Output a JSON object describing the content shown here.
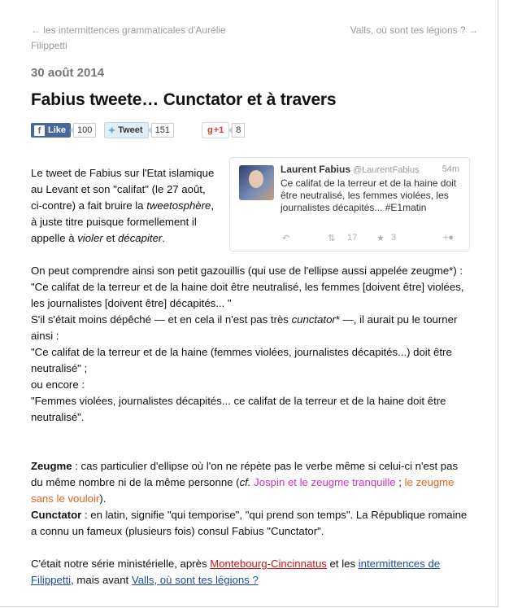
{
  "nav": {
    "prev_arrow": "←",
    "prev": "les intermittences grammaticales d'Aurélie Filippetti",
    "next": "Valls, où sont tes légions ?",
    "next_arrow": "→"
  },
  "post": {
    "date": "30 août 2014",
    "title": "Fabius tweete… Cunctator et à travers"
  },
  "share": {
    "fb_label": "Like",
    "fb_count": "100",
    "tw_label": "Tweet",
    "tw_count": "151",
    "gp_label": "+1",
    "gp_count": "8"
  },
  "tweet": {
    "name": "Laurent Fabius",
    "handle": "@LaurentFabius",
    "time": "54m",
    "text": "Ce califat de la terreur et de la haine doit être neutralisé, les femmes violées, les journalistes décapités... #E1matin",
    "retweets": "17",
    "favorites": "3"
  },
  "content": {
    "p1_a": "Le tweet de Fabius sur l'Etat islamique au Levant et son \"califat\" (le 27 août, ci-contre) a fait bruire la ",
    "p1_b": "tweetosphère",
    "p1_c": ", à juste titre puisque formellement il appelle à ",
    "p1_d": "violer",
    "p1_e": " et ",
    "p1_f": "décapiter",
    "p1_g": ".",
    "p2_a": "On peut comprendre ainsi son petit gazouillis (qui use de l'ellipse aussi appelée zeugme*) :",
    "p2_b": "\"Ce califat de la terreur et de la haine doit être neutralisé, les femmes [doivent être] violées, les journalistes [doivent être] décapités... \"",
    "p2_c": "S'il s'était moins dépêché — et en cela il n'est pas très ",
    "p2_d": "cunctator",
    "p2_e": "* —, il aurait pu le tourner ainsi :",
    "p2_f": "\"Ce califat de la terreur et de la haine (femmes violées, journalistes décapités...) doit être neutralisé\" ;",
    "p2_g": "ou encore :",
    "p2_h": "\"Femmes violées, journalistes décapités... ce califat de la terreur et de la haine doit être neutralisé\".",
    "p3_term1": "Zeugme",
    "p3_a": " : cas particulier d'ellipse où l'on ne répète pas le verbe même si celui-ci n'est pas du même nombre ni de la même personne (",
    "p3_cf": "cf.",
    "p3_link1": "Jospin et le zeugme tranquille",
    "p3_sep": " ; ",
    "p3_link2": "le zeugme sans le vouloir",
    "p3_b": ").",
    "p3_term2": "Cunctator",
    "p3_c": " : en latin, signifie \"qui temporise\", \"qui prend son temps\". La République romaine a connu un fameux (plusieurs fois) consul Fabius \"Cunctator\".",
    "p4_a": "C'était notre série ministérielle, après ",
    "p4_link1": "Montebourg-Cincinnatus",
    "p4_b": " et les ",
    "p4_link2": "intermittences de Filippetti",
    "p4_c": ", mais avant ",
    "p4_link3": "Valls, où sont tes légions ?"
  },
  "colors": {
    "facebook": "#4a66a0",
    "link_magenta": "#d030c0",
    "link_orange": "#e2631c",
    "link_red": "#c8161d",
    "link_blue": "#1a4da0"
  }
}
